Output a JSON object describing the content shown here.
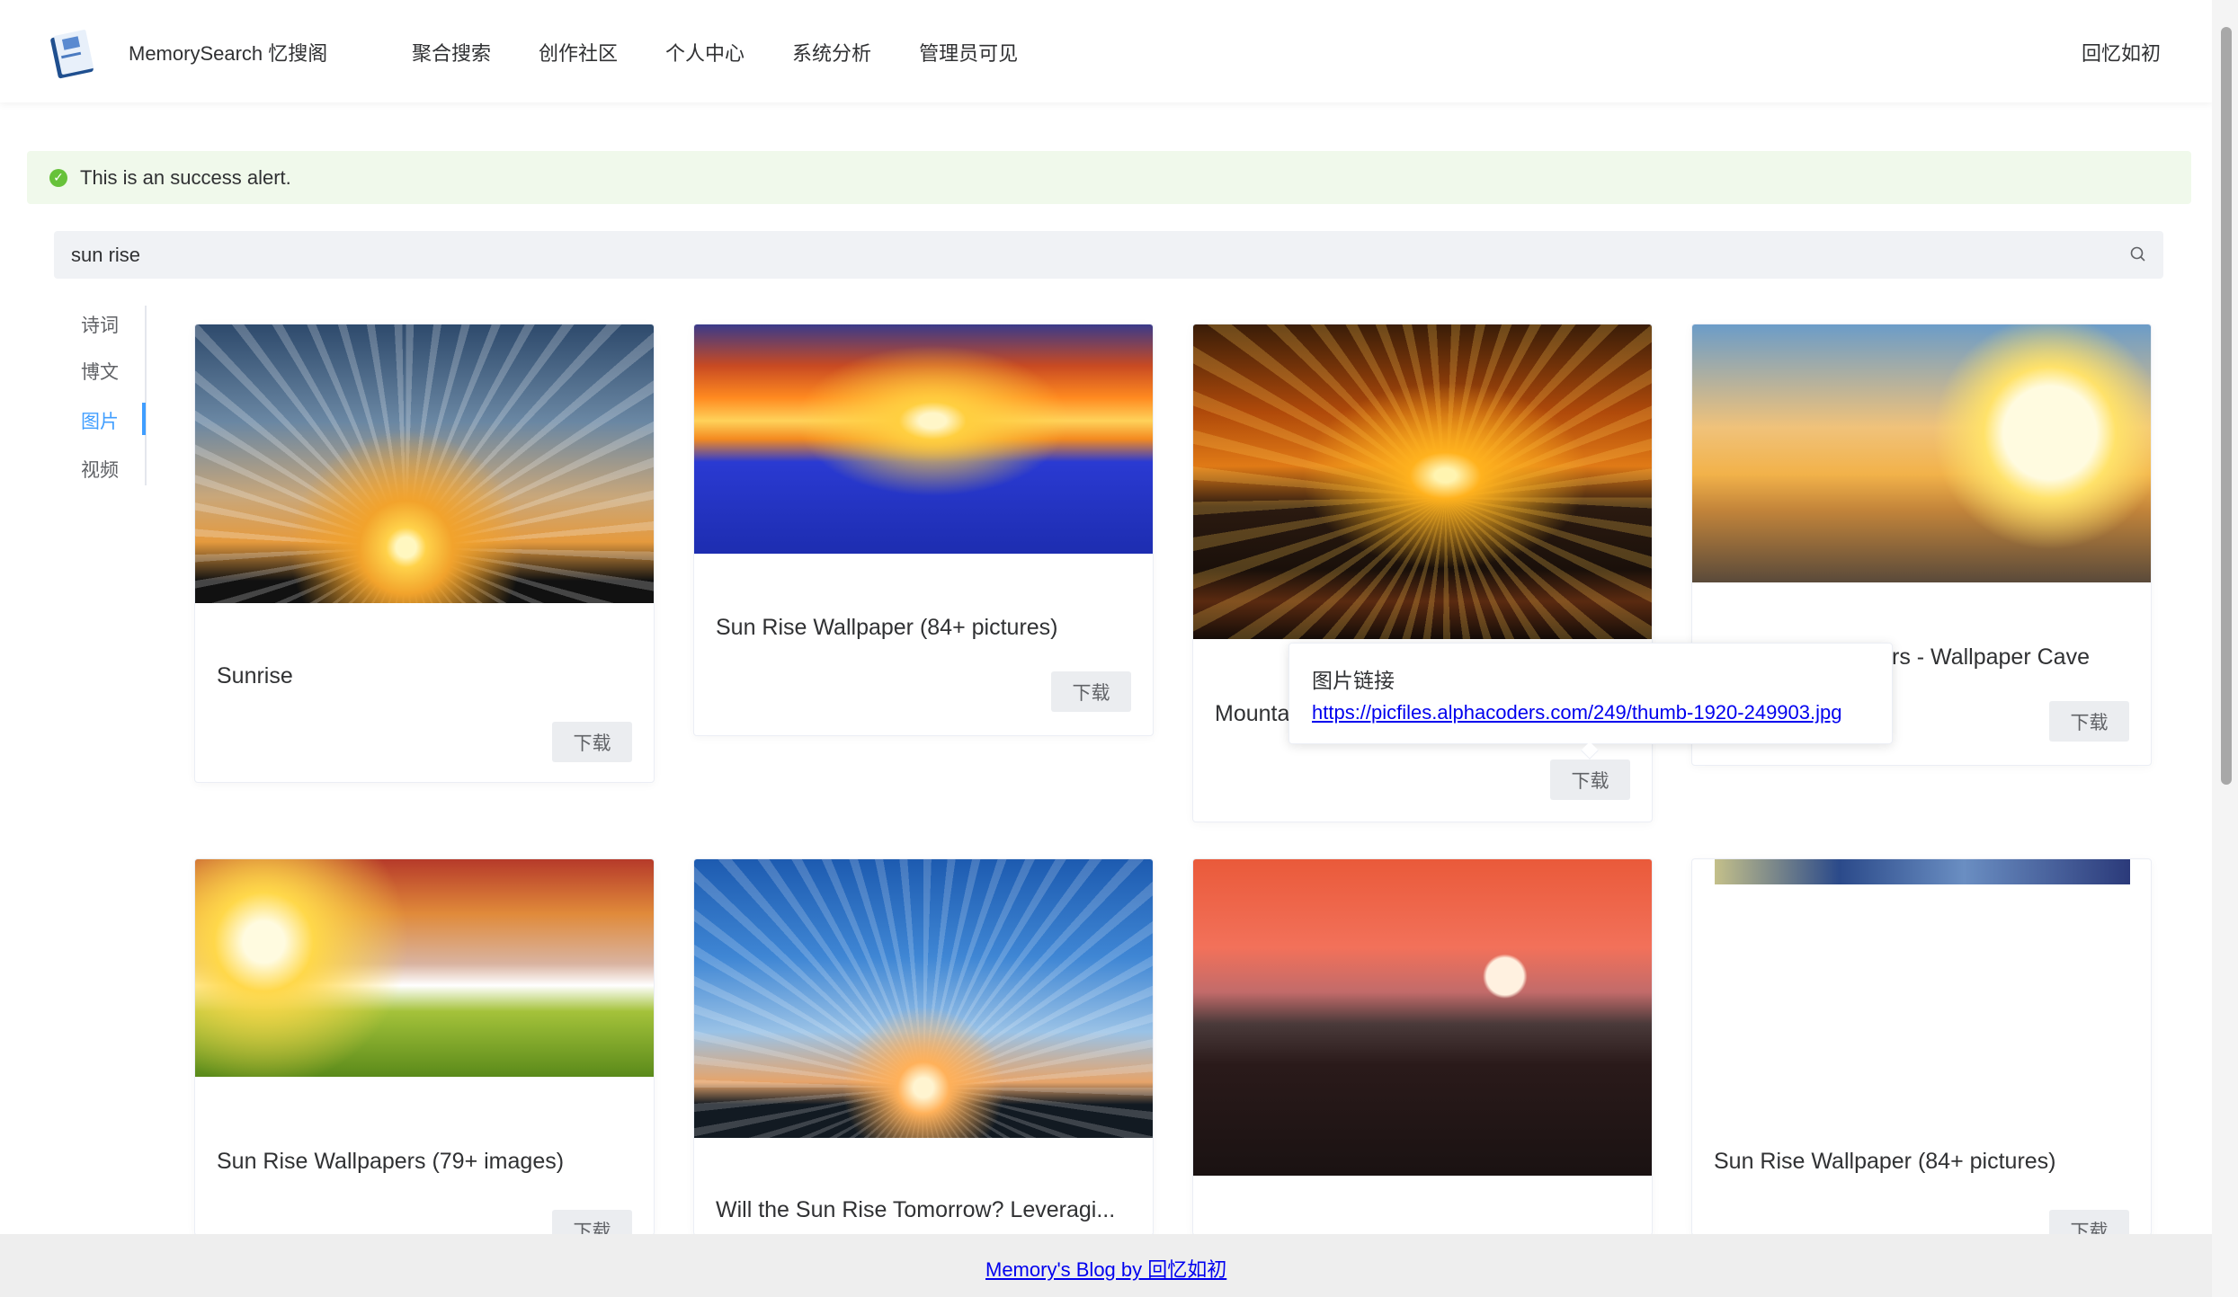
{
  "header": {
    "brand": "MemorySearch 忆搜阁",
    "nav": [
      "聚合搜索",
      "创作社区",
      "个人中心",
      "系统分析",
      "管理员可见"
    ],
    "user": "回忆如初"
  },
  "alert": {
    "text": "This is an success alert."
  },
  "search": {
    "value": "sun rise"
  },
  "tabs": {
    "items": [
      "诗词",
      "博文",
      "图片",
      "视频"
    ],
    "active": "图片"
  },
  "cards": [
    {
      "title": "Sunrise",
      "download": "下载"
    },
    {
      "title": "Sun Rise Wallpaper (84+ pictures)",
      "download": "下载"
    },
    {
      "title": "Mounta",
      "download": "下载"
    },
    {
      "title": "rs - Wallpaper Cave",
      "download": "下载"
    },
    {
      "title": "Sun Rise Wallpapers (79+ images)",
      "download": "下载"
    },
    {
      "title": "Will the Sun Rise Tomorrow? Leveragi...",
      "download": ""
    },
    {
      "title": "",
      "download": ""
    },
    {
      "title": "Sun Rise Wallpaper (84+ pictures)",
      "download": "下载"
    }
  ],
  "popover": {
    "title": "图片链接",
    "link": "https://picfiles.alphacoders.com/249/thumb-1920-249903.jpg"
  },
  "footer": {
    "link": "Memory's Blog by 回忆如初"
  }
}
